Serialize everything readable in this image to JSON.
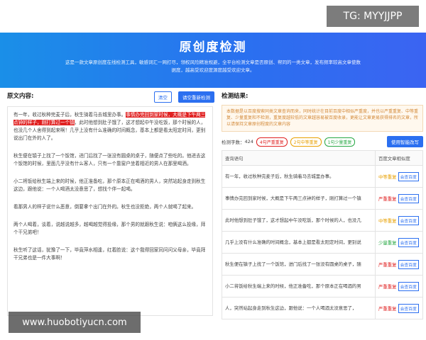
{
  "watermark_top": "TG: MYYJJPP",
  "watermark_bottom": "www.huobotiyucn.com",
  "banner": {
    "title": "原创度检测",
    "description": "这是一款文章原创度在线检测工具，敏感词汇一网打尽，领权风险精准规避，全平台检测文章是否原创、帮同的一类文章，发布频率较高文章使数据度，越高受欢迎度源度越受欢迎文章。"
  },
  "left": {
    "title": "原文内容:",
    "btn_clear": "清空",
    "btn_recheck": "请空重新检测",
    "paragraphs": [
      {
        "pre": "有一年，收过秋种完麦子后，秋生骑着马去城里办事。",
        "hl": "事情办完回到家时候，大概是下午两三点钟的样子，刚打算过一个镇",
        "post": "，此时他想到肚子饿了，这才想起中午没吃饭，那个时候的人，也没几个人舍得到起来啊！几乎上没有什么准确的时间概念，基本上都是看太阳定时间，更别说出门在外的人了。"
      },
      {
        "pre": "",
        "hl": "",
        "post": "秋生便在镇子上找了一个饭馆，进门后找了一张没有圆桌的桌子，随便点了些吃的。他进去这个饭馆的时候，里面几乎没有什么客人，只有一个靠窗户坐着相近的男人在那里喝酒。"
      },
      {
        "pre": "",
        "hl": "",
        "post": "小二将饭给秋生端上来的时候，他正准备吃，那个原本正在喝酒的男人，突然站起身走到秋生这边，跟他说：一个人喝酒太没意思了，想找个伴一起喝。"
      },
      {
        "pre": "",
        "hl": "",
        "post": "看那男人的样子说什么恶意，倒要拿个出门在外的。秋生也没拒绝，两个人就喝了起来。"
      },
      {
        "pre": "",
        "hl": "",
        "post": "两个人喝着，谈着，说越说越多，越喝越觉得投缘，那个男的就跟秋生说：咱俩这么投缘，拜个干兄弟吧！"
      },
      {
        "pre": "",
        "hl": "",
        "post": "秋生听了这话，犹豫了一下，毕竟萍水相逢，红着脸说：这个我得回家同问问父母亲，毕竟拜干兄弟也是一件大事啊！"
      }
    ]
  },
  "right": {
    "title": "检测结果:",
    "notice": "本数据是以百度搜索同类文章查询而来，同时统计在目前百度中相似严重度，并也以严重重复、中等重复、少量重复和不检测，重复度越较低的文章越容易被百度收录，更能让文章更易获得排名的文章，所以请保持文章原创程度的文章内容",
    "stats": {
      "label": "检测字数：",
      "count": "424",
      "badge_severe": "4句严重重复",
      "badge_medium": "2句中等重复",
      "badge_light": "1句少量重复",
      "btn_smart": "使用智能改写"
    },
    "table": {
      "col_sentence": "查询语句",
      "col_level": "百度文章相似度",
      "search_label": "会查百度",
      "rows": [
        {
          "sentence": "有一年，收过秋种完麦子后，秋生骑着马去城里办事。",
          "level": "中等重复",
          "color": "orange"
        },
        {
          "sentence": "事情办完回到家时候，大概是下午两三点钟的样子，刚打算过一个镇",
          "level": "严重重复",
          "color": "red"
        },
        {
          "sentence": "此时他想到肚子饿了，这才想起中午没吃饭，那个时候的人，也没几",
          "level": "中等重复",
          "color": "orange"
        },
        {
          "sentence": "几乎上没有什么准确的时间概念，基本上都是看太阳定时间，更别说",
          "level": "少量重复",
          "color": "green"
        },
        {
          "sentence": "秋生便在镇子上找了一个饭馆，进门后找了一张没有圆桌的桌子，随",
          "level": "严重重复",
          "color": "red"
        },
        {
          "sentence": "小二将饭给秋生端上来的时候，他正准备吃，那个原本正在喝酒的男",
          "level": "严重重复",
          "color": "red"
        },
        {
          "sentence": "人，突然站起身走到秋生这边，跟他说：一个人喝酒太没意思了，",
          "level": "严重重复",
          "color": "red"
        }
      ]
    }
  },
  "colors": {
    "accent": "#2b6ff0",
    "severe": "#e02020",
    "medium": "#e8a000",
    "light": "#27a844"
  }
}
